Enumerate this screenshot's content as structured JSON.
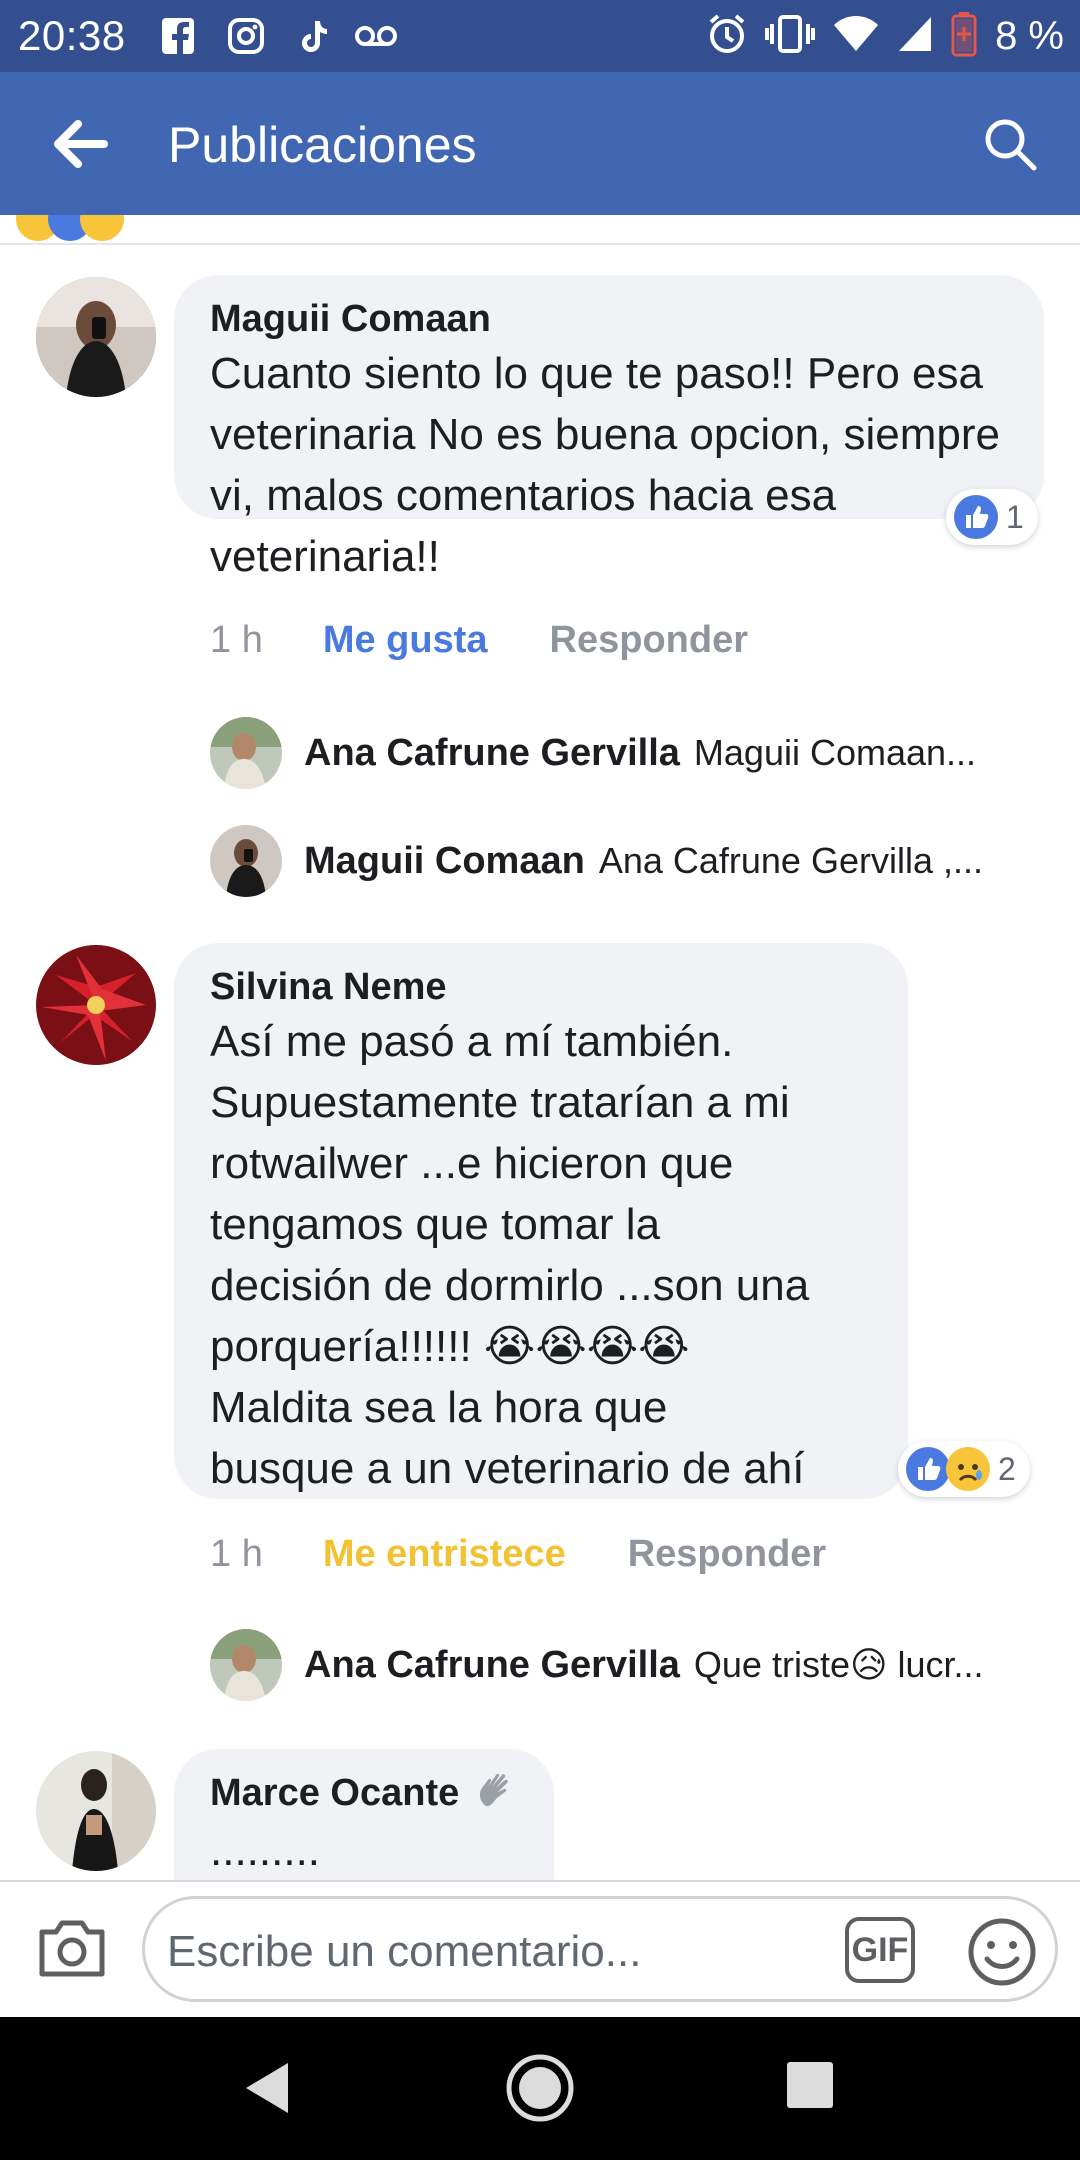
{
  "status_bar": {
    "time": "20:38",
    "battery": "8 %",
    "icons": [
      "facebook-icon",
      "instagram-icon",
      "tiktok-icon",
      "voicemail-icon",
      "alarm-icon",
      "vibrate-icon",
      "wifi-icon",
      "signal-icon",
      "battery-icon"
    ]
  },
  "appbar": {
    "title": "Publicaciones",
    "back_icon": "arrow-left-icon",
    "search_icon": "search-icon"
  },
  "comments": [
    {
      "name": "Maguii Comaan",
      "text": "Cuanto siento lo que te paso!! Pero esa veterinaria No es buena opcion, siempre vi, malos comentarios hacia esa veterinaria!!",
      "time": "1 h",
      "reaction_label": "Me gusta",
      "reply_label": "Responder",
      "reaction_count": "1",
      "replies": [
        {
          "name": "Ana Cafrune Gervilla",
          "text": "Maguii Comaan..."
        },
        {
          "name": "Maguii Comaan",
          "text": "Ana Cafrune Gervilla ,..."
        }
      ]
    },
    {
      "name": "Silvina Neme",
      "text_lines": [
        "Así me pasó a mí también.",
        "Supuestamente tratarían a mi",
        "rotwailwer ...e hicieron que",
        "tengamos que tomar la",
        "decisión de dormirlo ...son una",
        "porquería!!!!!! 😭😭😭😭",
        "Maldita sea la hora que",
        "busque a un veterinario de ahí"
      ],
      "time": "1 h",
      "reaction_label": "Me entristece",
      "reply_label": "Responder",
      "reaction_count": "2",
      "replies": [
        {
          "name": "Ana Cafrune Gervilla",
          "text": "Que triste😥 lucr..."
        }
      ]
    },
    {
      "name": "Marce Ocante",
      "text": "........."
    }
  ],
  "composer": {
    "placeholder": "Escribe un comentario...",
    "gif_label": "GIF",
    "camera_icon": "camera-icon",
    "emoji_icon": "emoji-icon"
  },
  "nav": {
    "back": "nav-back-icon",
    "home": "nav-home-icon",
    "recents": "nav-recents-icon"
  },
  "colors": {
    "status_bar": "#344f8f",
    "app_bar": "#4267b2",
    "like_blue": "#4a7ae0",
    "sad_yellow": "#f1c232"
  }
}
